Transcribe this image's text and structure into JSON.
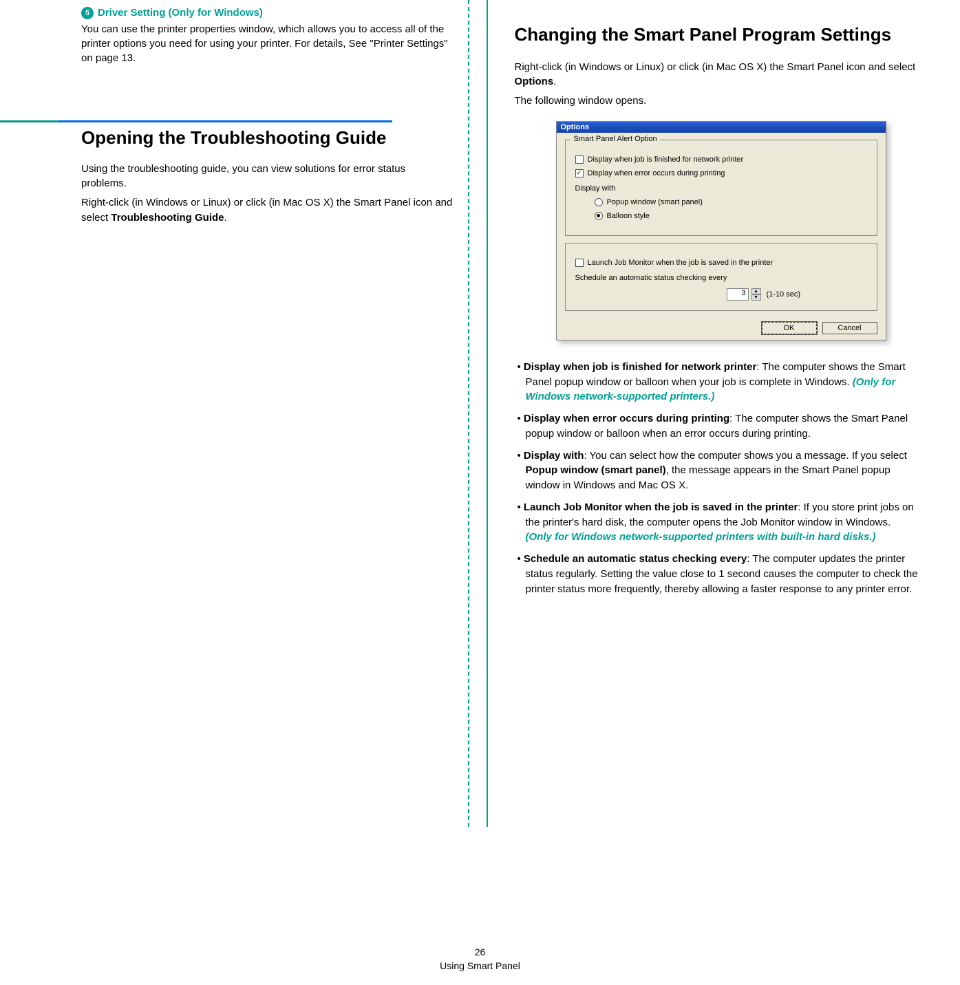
{
  "left": {
    "bullet_number": "5",
    "bullet_heading": "Driver Setting (Only for Windows)",
    "bullet_body": "You can use the printer properties window, which allows you to access all of the printer options you need for using your printer. For details, See \"Printer Settings\" on page 13.",
    "section_heading": "Opening the Troubleshooting Guide",
    "para1": "Using the troubleshooting guide, you can view solutions for error status problems.",
    "para2_pre": "Right-click (in Windows or Linux) or click (in Mac OS X) the Smart Panel icon and select ",
    "para2_bold": "Troubleshooting Guide",
    "para2_post": "."
  },
  "right": {
    "section_heading": "Changing the Smart Panel Program Settings",
    "intro_pre": "Right-click (in Windows or Linux) or click (in Mac OS X) the Smart Panel icon and select ",
    "intro_bold": "Options",
    "intro_post": ".",
    "intro2": "The following window opens.",
    "dialog": {
      "title": "Options",
      "group1_legend": "Smart Panel Alert Option",
      "chk1": "Display when job is finished for network printer",
      "chk1_checked": false,
      "chk2": "Display when error occurs during printing",
      "chk2_checked": true,
      "display_with_label": "Display with",
      "radio1": "Popup window (smart panel)",
      "radio2": "Balloon style",
      "radio_selected": "Balloon style",
      "chk3": "Launch Job Monitor when the job is saved in the printer",
      "chk3_checked": false,
      "schedule_label": "Schedule an automatic status checking every",
      "spin_value": "3",
      "spin_range": "(1-10 sec)",
      "ok": "OK",
      "cancel": "Cancel"
    },
    "bullets": [
      {
        "lead": "Display when job is finished for network printer",
        "body": ": The computer shows the Smart Panel popup window or balloon when your job is complete in Windows. ",
        "note": "(Only for Windows network-supported printers.)"
      },
      {
        "lead": "Display when error occurs during printing",
        "body": ": The computer shows the Smart Panel popup window or balloon when an error occurs during printing.",
        "note": ""
      },
      {
        "lead": "Display with",
        "body": ": You can select how the computer shows you a message. If you select ",
        "inline_bold": "Popup window (smart panel)",
        "body2": ", the message appears in the Smart Panel popup window in Windows and Mac OS X.",
        "note": ""
      },
      {
        "lead": "Launch Job Monitor when the job is saved in the printer",
        "body": ": If you store print jobs on the printer's hard disk, the computer opens the Job Monitor window in Windows. ",
        "note": "(Only for Windows network-supported printers with built-in hard disks.)"
      },
      {
        "lead": "Schedule an automatic status checking every",
        "body": ": The computer updates the printer status regularly. Setting the value close to 1 second causes the computer to check the printer status more frequently, thereby allowing a faster response to any printer error.",
        "note": ""
      }
    ]
  },
  "footer": {
    "page": "26",
    "title": "Using Smart Panel"
  }
}
